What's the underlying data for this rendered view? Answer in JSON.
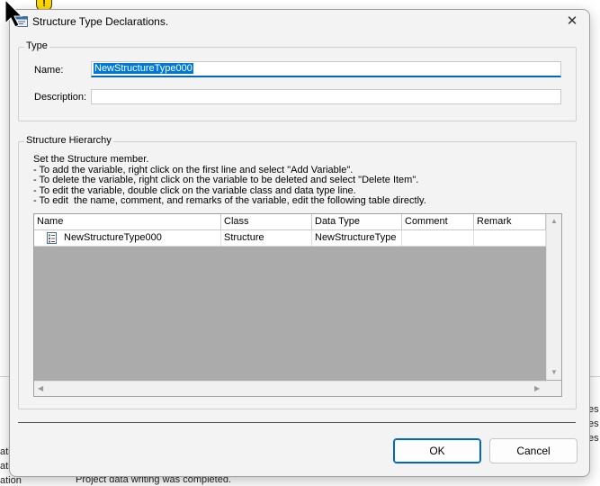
{
  "background": {
    "right_fragments": [
      "es",
      "es",
      "es"
    ],
    "left_fragments": [
      "ati",
      "ati",
      "ation"
    ],
    "status_message": "Project data writing was completed."
  },
  "dialog": {
    "title": "Structure Type Declarations.",
    "close_glyph": "✕"
  },
  "type_group": {
    "legend": "Type",
    "name_label": "Name:",
    "name_value": "NewStructureType000",
    "description_label": "Description:",
    "description_value": ""
  },
  "hierarchy_group": {
    "legend": "Structure Hierarchy",
    "help_lines": [
      "Set the Structure member.",
      "- To add the variable, right click on the first line and select \"Add Variable\".",
      "- To delete the variable, right click on the variable to be deleted and select \"Delete Item\".",
      "- To edit the variable, double click on the variable class and data type line.",
      "- To edit  the name, comment, and remarks of the variable, edit the following table directly."
    ],
    "table": {
      "columns": [
        "Name",
        "Class",
        "Data Type",
        "Comment",
        "Remark"
      ],
      "rows": [
        {
          "name": "NewStructureType000",
          "class": "Structure",
          "data_type": "NewStructureType",
          "comment": "",
          "remark": ""
        }
      ]
    }
  },
  "buttons": {
    "ok": "OK",
    "cancel": "Cancel"
  },
  "icons": {
    "cursor": "mouse-pointer-icon",
    "warning": "warning-icon",
    "app": "dialog-app-icon",
    "close": "close-icon",
    "row": "structure-icon"
  },
  "colors": {
    "accent": "#0067c0",
    "selection": "#0078d7",
    "grid_empty": "#ababab"
  }
}
